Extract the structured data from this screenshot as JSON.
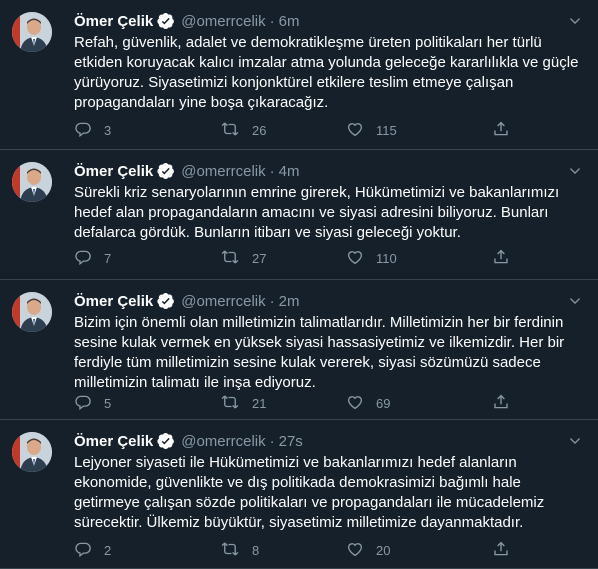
{
  "tweets": [
    {
      "name": "Ömer Çelik",
      "handle": "@omerrcelik",
      "time": "6m",
      "text": "Refah, güvenlik, adalet ve demokratikleşme üreten politikaları her türlü etkiden koruyacak kalıcı imzalar atma yolunda geleceğe kararlılıkla ve güçle yürüyoruz. Siyasetimizi konjonktürel etkilere teslim etmeye çalışan propagandaları yine boşa çıkaracağız.",
      "replies": "3",
      "retweets": "26",
      "likes": "115"
    },
    {
      "name": "Ömer Çelik",
      "handle": "@omerrcelik",
      "time": "4m",
      "text": "Sürekli kriz senaryolarının emrine girerek, Hükümetimizi ve bakanlarımızı hedef alan propagandaların amacını ve siyasi adresini biliyoruz. Bunları defalarca gördük. Bunların itibarı ve siyasi geleceği yoktur.",
      "replies": "7",
      "retweets": "27",
      "likes": "110"
    },
    {
      "name": "Ömer Çelik",
      "handle": "@omerrcelik",
      "time": "2m",
      "text": "Bizim için önemli olan milletimizin talimatlarıdır. Milletimizin her bir ferdinin sesine kulak vermek en yüksek siyasi hassasiyetimiz ve ilkemizdir. Her bir ferdiyle tüm milletimizin sesine kulak vererek, siyasi sözümüzü sadece milletimizin talimatı ile inşa ediyoruz.",
      "replies": "5",
      "retweets": "21",
      "likes": "69"
    },
    {
      "name": "Ömer Çelik",
      "handle": "@omerrcelik",
      "time": "27s",
      "text": "Lejyoner siyaseti ile Hükümetimizi ve bakanlarımızı hedef alanların ekonomide, güvenlikte ve dış politikada demokrasimizi bağımlı hale getirmeye çalışan sözde politikaları ve propagandaları ile mücadelemiz sürecektir. Ülkemiz büyüktür, siyasetimiz milletimize dayanmaktadır.",
      "replies": "2",
      "retweets": "8",
      "likes": "20"
    }
  ],
  "separator": "·",
  "colors": {
    "background": "#15202b",
    "border": "#38444d",
    "muted": "#8899a6",
    "verified": "#ffffff"
  },
  "icons": [
    "verified-badge-icon",
    "chevron-down-icon",
    "reply-icon",
    "retweet-icon",
    "like-icon",
    "share-icon"
  ]
}
